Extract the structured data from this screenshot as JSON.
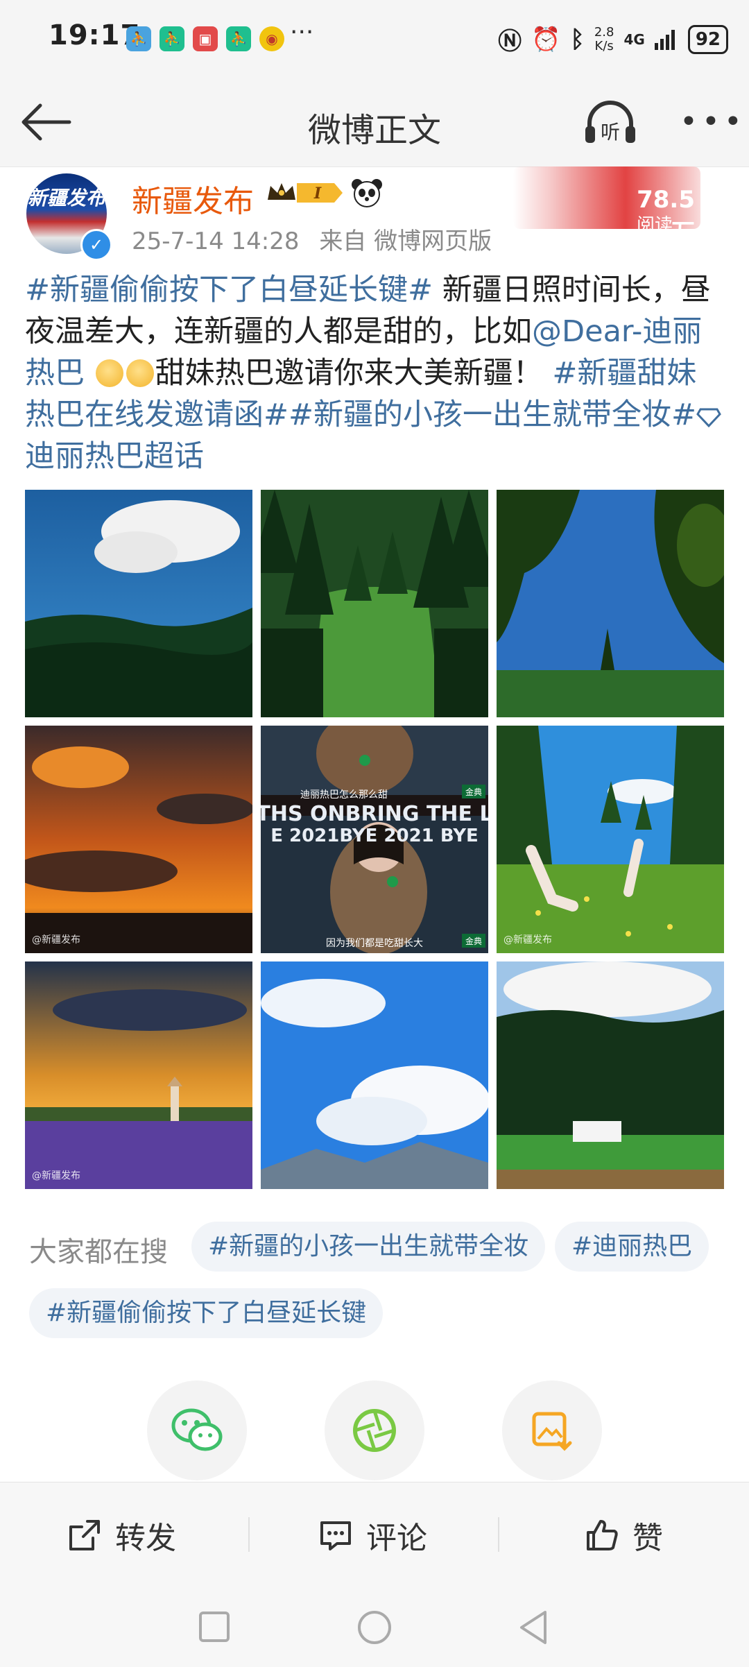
{
  "status_bar": {
    "time": "19:17",
    "more": "···",
    "speed": [
      "2.8",
      "K/s"
    ],
    "network": "4G",
    "battery": "92"
  },
  "nav": {
    "title": "微博正文",
    "listen_label": "听"
  },
  "post": {
    "author": "新疆发布",
    "avatar_text": "新疆发布",
    "badge_level": "I",
    "timestamp": "25-7-14 14:28",
    "source": "来自 微博网页版",
    "reads_count": "78.5万",
    "reads_label": "阅读",
    "text_segments": {
      "tag1": "#新疆偷偷按下了白昼延长键#",
      "plain1": " 新疆日照时间长，昼夜温差大，连新疆的人都是甜的，比如",
      "mention": "@Dear-迪丽热巴",
      "plain2": "甜妹热巴邀请你来大美新疆！",
      "tag2": "#新疆甜妹热巴在线发邀请函#",
      "tag3": "#新疆的小孩一出生就带全妆#",
      "tag4": "迪丽热巴超话"
    },
    "photos": [
      {
        "name": "photo-sky-forest",
        "watermark": ""
      },
      {
        "name": "photo-pine-meadow",
        "watermark": ""
      },
      {
        "name": "photo-lake-trees",
        "watermark": ""
      },
      {
        "name": "photo-sunset-clouds",
        "watermark": "@新疆发布"
      },
      {
        "name": "photo-dilraba-stage",
        "watermark": "",
        "caption_top": "迪丽热巴怎么那么甜",
        "caption_bottom": "因为我们都是吃甜长大",
        "stage_text_top": "THS ONBRING THE L",
        "stage_text_bottom": "E 2021BYE 2021 BYE",
        "logo": "金典"
      },
      {
        "name": "photo-meadow-legs",
        "watermark": "@新疆发布"
      },
      {
        "name": "photo-lavender-field",
        "watermark": "@新疆发布"
      },
      {
        "name": "photo-blue-sky-clouds",
        "watermark": ""
      },
      {
        "name": "photo-forest-cabin",
        "watermark": ""
      }
    ]
  },
  "search": {
    "label": "大家都在搜",
    "chips": [
      "#新疆的小孩一出生就带全妆",
      "#迪丽热巴",
      "#新疆偷偷按下了白昼延长键"
    ]
  },
  "actions": {
    "repost": "转发",
    "comment": "评论",
    "like": "赞"
  },
  "colors": {
    "link": "#3f6e9e",
    "author": "#e8590c",
    "wechat": "#3fbf6a",
    "moments": "#7ac943",
    "save": "#f5a623"
  }
}
